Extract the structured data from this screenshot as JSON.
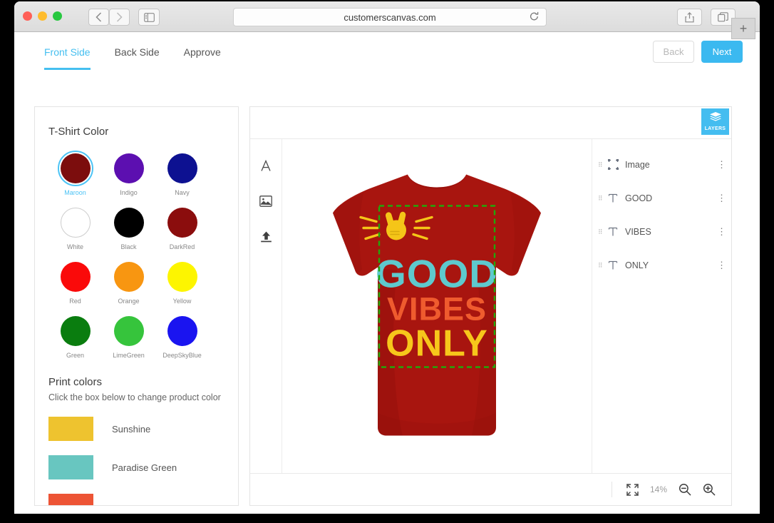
{
  "browser": {
    "url": "customerscanvas.com",
    "reload_icon": "reload-icon",
    "back_icon": "chevron-left-icon",
    "forward_icon": "chevron-right-icon",
    "sidebar_icon": "sidebar-toggle-icon",
    "share_icon": "share-icon",
    "tabs_icon": "show-tabs-icon",
    "newtab_label": "+"
  },
  "topbar": {
    "tabs": [
      {
        "label": "Front Side",
        "active": true
      },
      {
        "label": "Back Side",
        "active": false
      },
      {
        "label": "Approve",
        "active": false
      }
    ],
    "back_label": "Back",
    "next_label": "Next",
    "accent": "#3bb9f0"
  },
  "sidebar": {
    "tshirt_title": "T-Shirt Color",
    "colors": [
      {
        "name": "Maroon",
        "hex": "#7c0d0d",
        "selected": true
      },
      {
        "name": "Indigo",
        "hex": "#5c0fb0",
        "selected": false
      },
      {
        "name": "Navy",
        "hex": "#0d1191",
        "selected": false
      },
      {
        "name": "White",
        "hex": "#ffffff",
        "selected": false
      },
      {
        "name": "Black",
        "hex": "#000000",
        "selected": false
      },
      {
        "name": "DarkRed",
        "hex": "#8b0d0d",
        "selected": false
      },
      {
        "name": "Red",
        "hex": "#fa0a0a",
        "selected": false
      },
      {
        "name": "Orange",
        "hex": "#f89611",
        "selected": false
      },
      {
        "name": "Yellow",
        "hex": "#fdf500",
        "selected": false
      },
      {
        "name": "Green",
        "hex": "#0a7d0f",
        "selected": false
      },
      {
        "name": "LimeGreen",
        "hex": "#36c43c",
        "selected": false
      },
      {
        "name": "DeepSkyBlue",
        "hex": "#1a14f0",
        "selected": false
      }
    ],
    "print_title": "Print colors",
    "print_hint": "Click the box below to change product color",
    "print_colors": [
      {
        "name": "Sunshine",
        "hex": "#eec32f"
      },
      {
        "name": "Paradise Green",
        "hex": "#68c6c0"
      },
      {
        "name": "",
        "hex": "#ed5435"
      }
    ]
  },
  "editor": {
    "layers_label": "LAYERS",
    "layers_icon": "layers-stack-icon",
    "tools": [
      {
        "name": "add-text-tool",
        "icon": "letter-a-icon"
      },
      {
        "name": "add-image-tool",
        "icon": "picture-icon"
      },
      {
        "name": "upload-tool",
        "icon": "upload-arrow-icon"
      }
    ],
    "layers": [
      {
        "name": "Image",
        "icon": "selection-frame-icon"
      },
      {
        "name": "GOOD",
        "icon": "text-t-icon"
      },
      {
        "name": "VIBES",
        "icon": "text-t-icon"
      },
      {
        "name": "ONLY",
        "icon": "text-t-icon"
      }
    ],
    "zoom_value": "14%",
    "fit_icon": "fit-to-screen-icon",
    "zoom_out_icon": "zoom-out-icon",
    "zoom_in_icon": "zoom-in-icon"
  },
  "design": {
    "shirt_color": "#a8150f",
    "shirt_shade": "#8d0f0b",
    "selection_color": "#22a80a",
    "lines": [
      {
        "text": "GOOD",
        "hex": "#5ec9cd"
      },
      {
        "text": "VIBES",
        "hex": "#ef5b2e"
      },
      {
        "text": "ONLY",
        "hex": "#f7c71b"
      }
    ],
    "emblem": {
      "icon": "peace-hand-icon",
      "hex": "#f5c518"
    }
  }
}
